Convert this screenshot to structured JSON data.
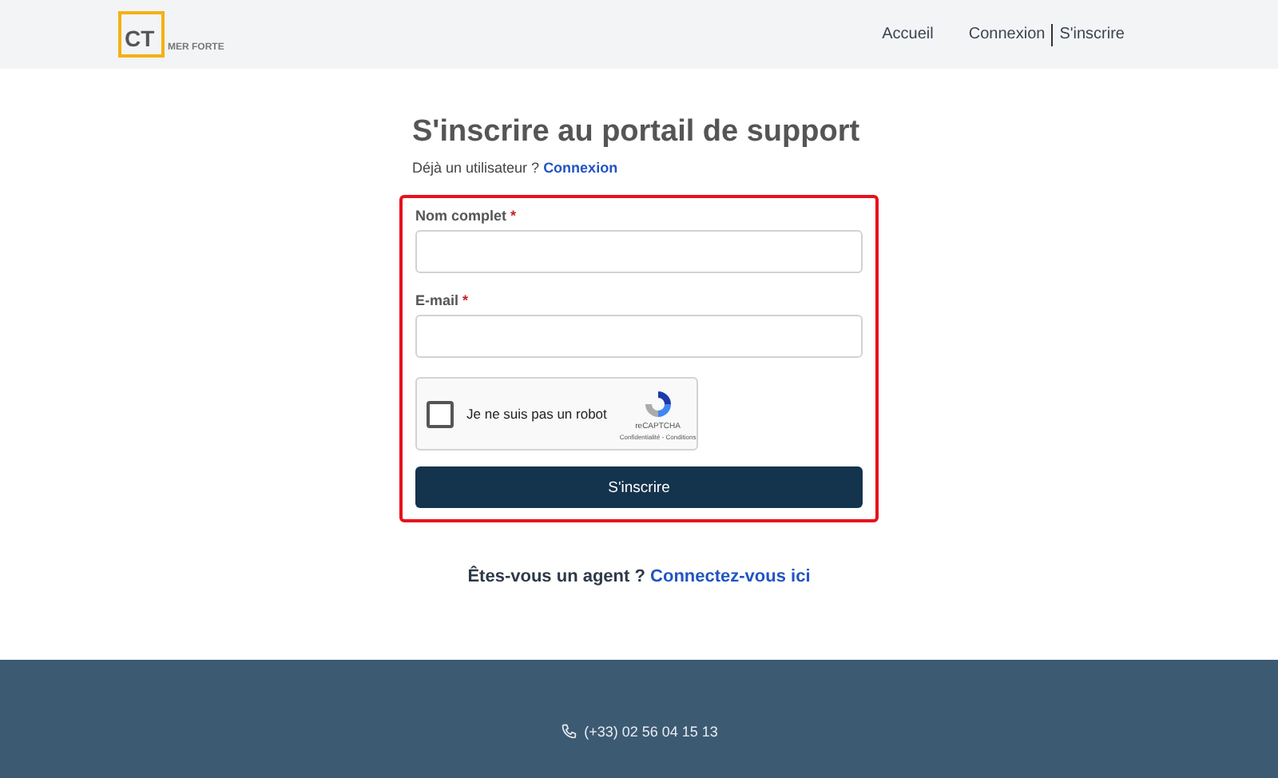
{
  "header": {
    "logo": {
      "mark": "CT",
      "name": "MER FORTE"
    },
    "nav": [
      {
        "label": "Accueil"
      },
      {
        "label": "Connexion"
      },
      {
        "label": "S'inscrire"
      }
    ]
  },
  "page": {
    "title": "S'inscrire au portail de support",
    "subtitle": "Déjà un utilisateur ?",
    "subtitle_link": "Connexion"
  },
  "form": {
    "fields": [
      {
        "label": "Nom complet",
        "marker": "*"
      },
      {
        "label": "E-mail",
        "marker": "*"
      }
    ],
    "captcha": {
      "label": "Je ne suis pas un robot",
      "checked": false,
      "brand": "reCAPTCHA",
      "terms": "Confidentialité - Conditions"
    },
    "submit": "S'inscrire"
  },
  "agent": {
    "text": "Êtes-vous un agent ?",
    "link": "Connectez-vous ici"
  },
  "footer": {
    "phone": "(+33) 02 56 04 15 13"
  }
}
